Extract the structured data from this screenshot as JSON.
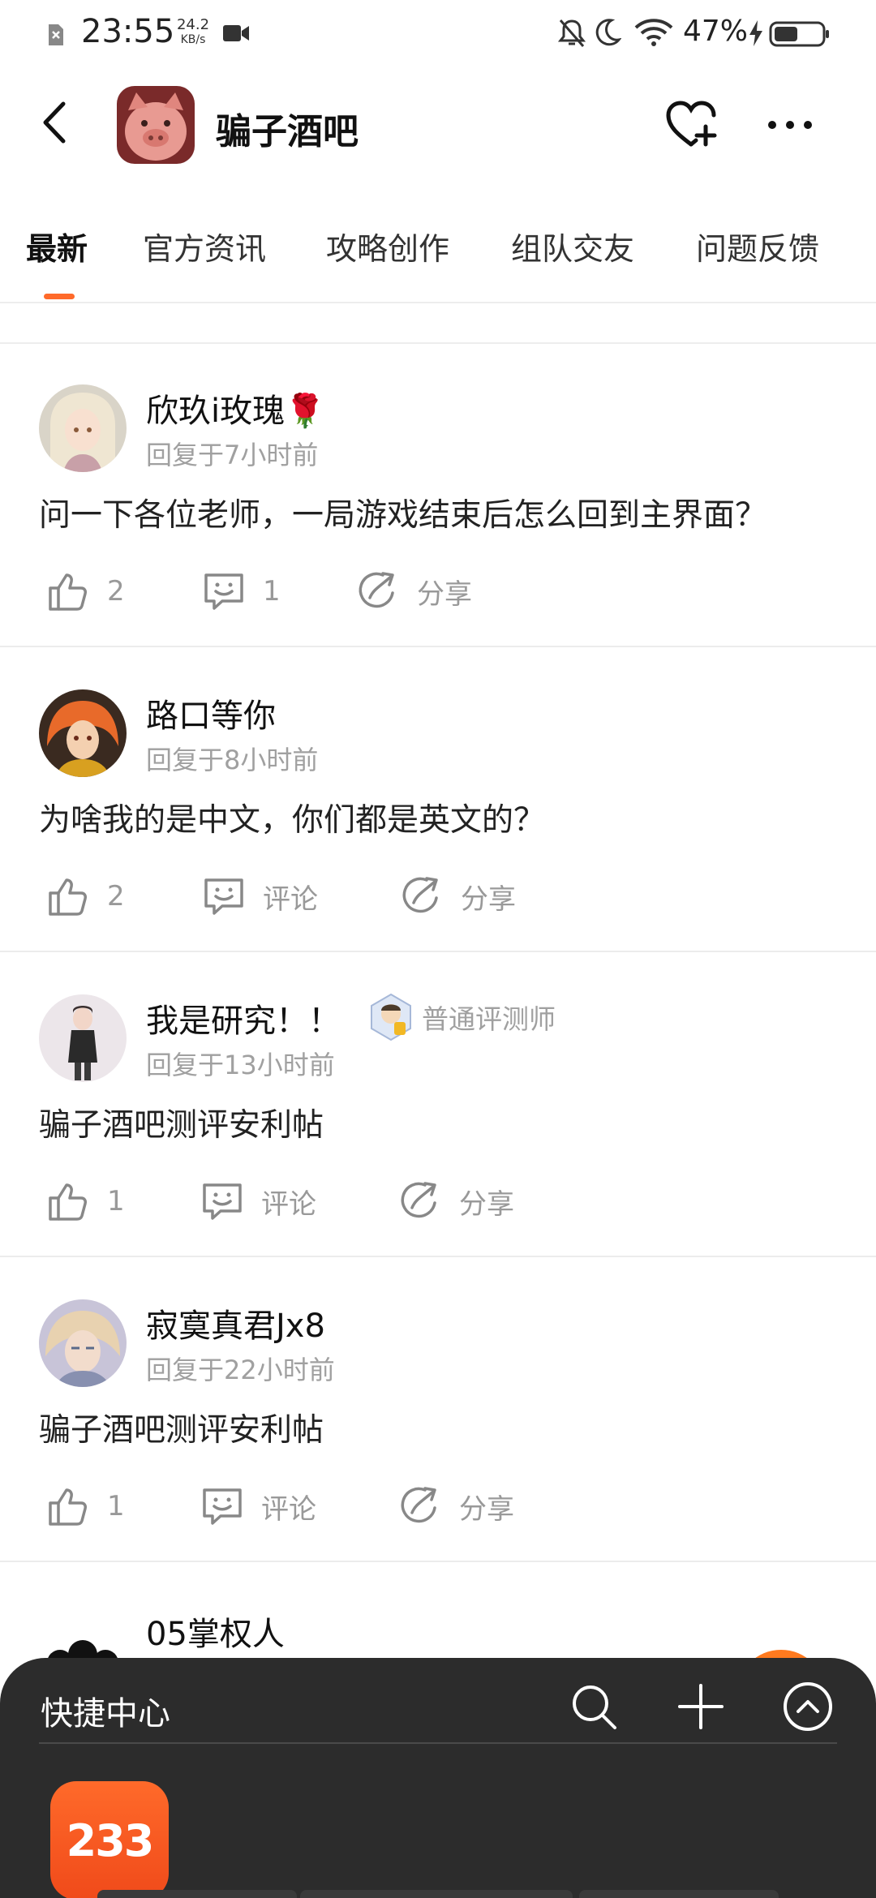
{
  "status_bar": {
    "time": "23:55",
    "net_speed": "24.2",
    "net_speed_unit": "KB/s",
    "battery": "47%"
  },
  "header": {
    "title": "骗子酒吧"
  },
  "tabs": [
    {
      "label": "最新"
    },
    {
      "label": "官方资讯"
    },
    {
      "label": "攻略创作"
    },
    {
      "label": "组队交友"
    },
    {
      "label": "问题反馈"
    }
  ],
  "posts": [
    {
      "username": "欣玖i玫瑰🌹",
      "time": "回复于7小时前",
      "content": "问一下各位老师，一局游戏结束后怎么回到主界面？",
      "likes": "2",
      "comments": "1",
      "share": "分享"
    },
    {
      "username": "路口等你",
      "time": "回复于8小时前",
      "content": "为啥我的是中文，你们都是英文的？",
      "likes": "2",
      "comments": "评论",
      "share": "分享"
    },
    {
      "username": "我是研究！！",
      "badge": "普通评测师",
      "time": "回复于13小时前",
      "content": "骗子酒吧测评安利帖",
      "likes": "1",
      "comments": "评论",
      "share": "分享"
    },
    {
      "username": "寂寞真君Jx8",
      "time": "回复于22小时前",
      "content": "骗子酒吧测评安利帖",
      "likes": "1",
      "comments": "评论",
      "share": "分享"
    }
  ],
  "partial_post": {
    "username": "05掌权人"
  },
  "quick_panel": {
    "title": "快捷中心",
    "app_label": "233"
  },
  "colors": {
    "accent": "#ff6a2a",
    "panel_bg": "#2c2c2c"
  }
}
